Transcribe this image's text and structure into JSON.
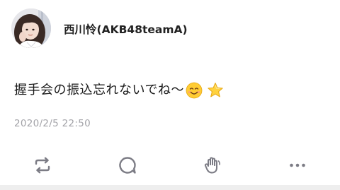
{
  "post": {
    "author": "西川怜(AKB48teamA)",
    "text": "握手会の振込忘れないでね〜",
    "timestamp": "2020/2/5 22:50"
  },
  "icons": {
    "avatar": "avatar-photo",
    "emoji_1": "smiling-face-icon",
    "emoji_2": "star-icon",
    "repost": "repost-icon",
    "comment": "comment-icon",
    "applause": "clapping-hands-icon",
    "more": "more-icon"
  },
  "colors": {
    "text": "#1a1a1a",
    "timestamp": "#a3a3a8",
    "action_icon": "#7c7c85",
    "background": "#ffffff"
  }
}
